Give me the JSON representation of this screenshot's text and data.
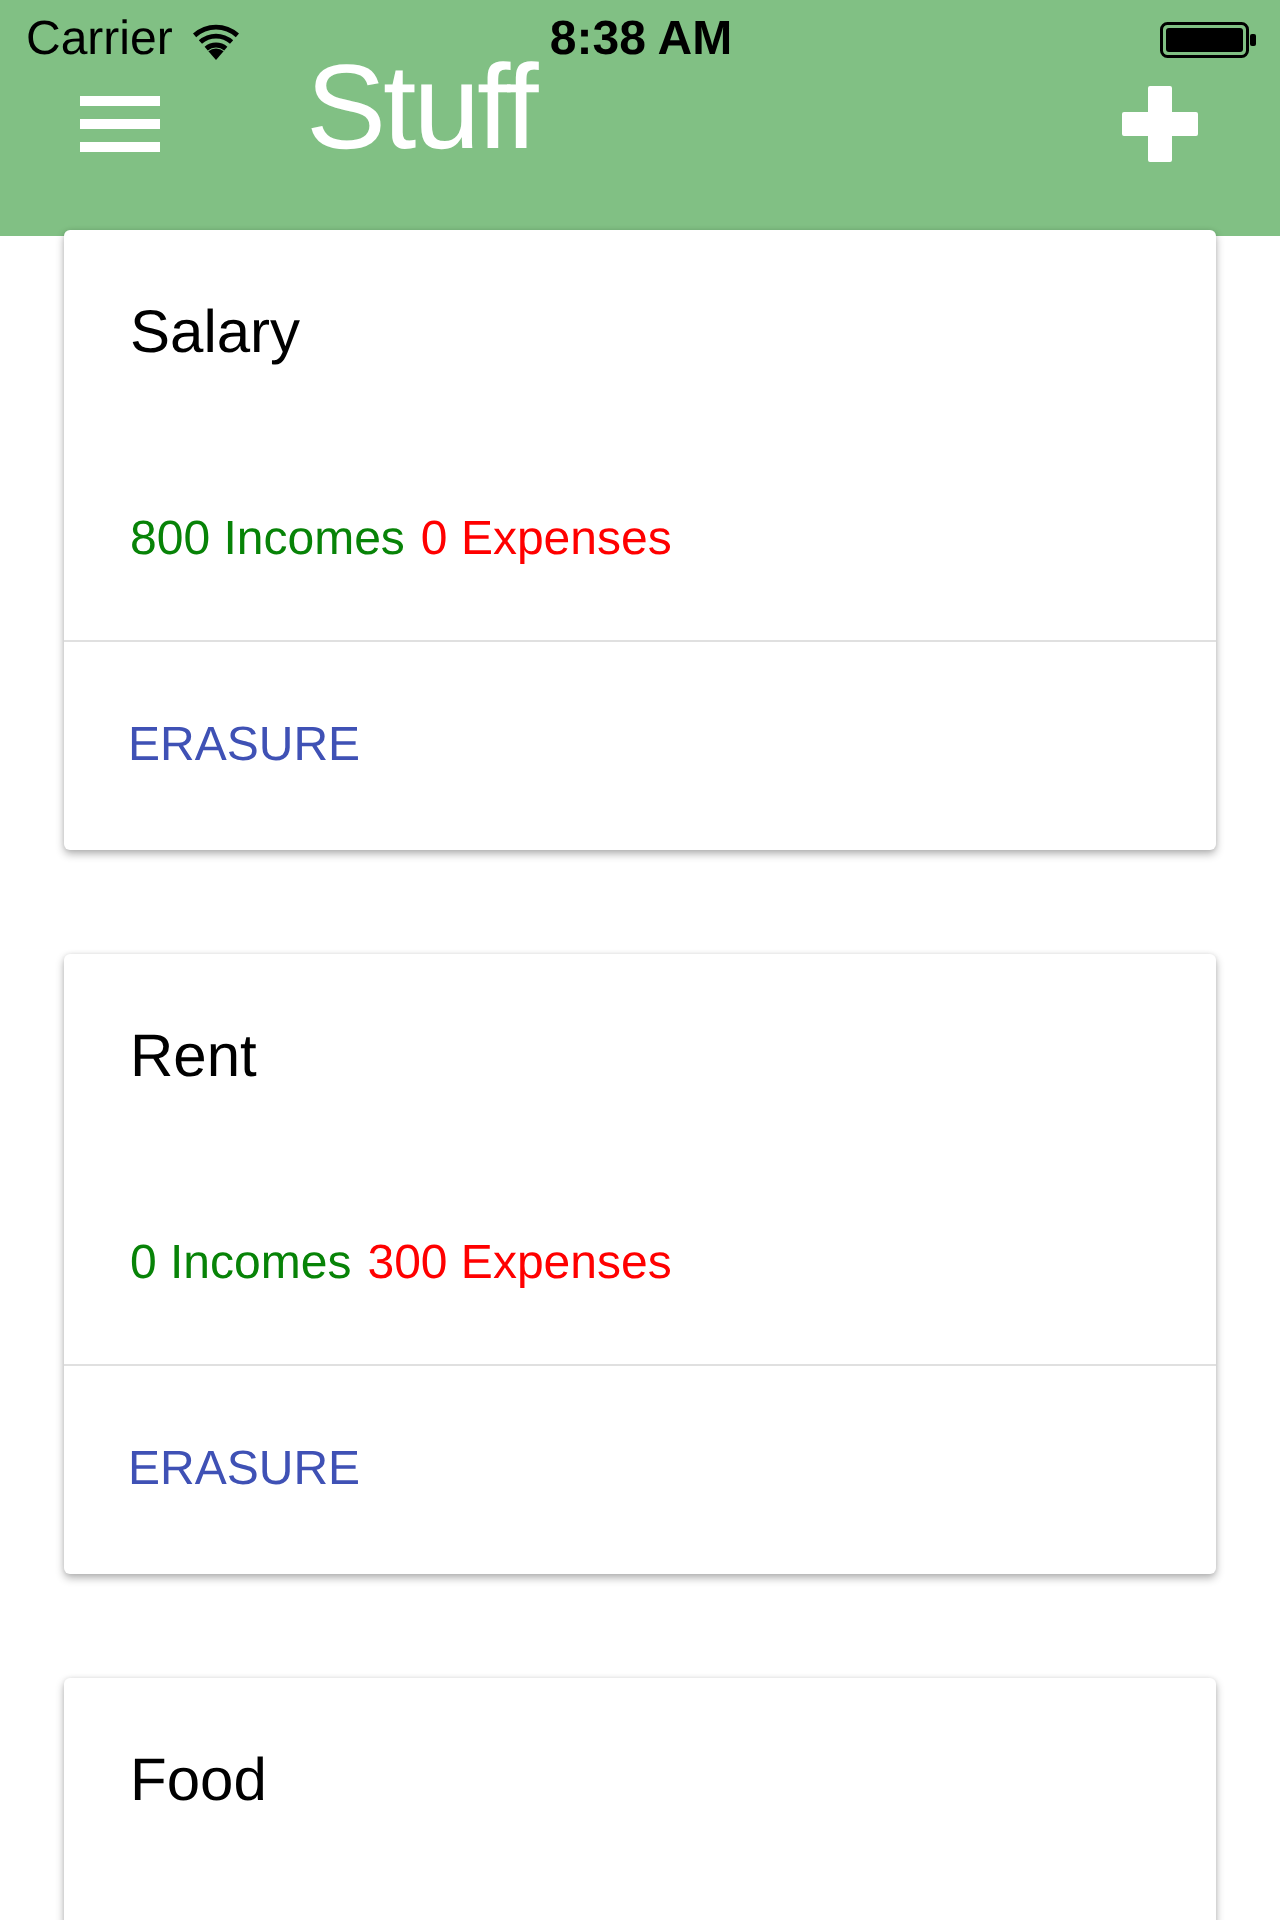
{
  "status_bar": {
    "carrier": "Carrier",
    "time": "8:38 AM"
  },
  "header": {
    "title": "Stuff"
  },
  "cards": [
    {
      "title": "Salary",
      "incomes": "800 Incomes",
      "expenses": "0 Expenses",
      "action": "ERASURE"
    },
    {
      "title": "Rent",
      "incomes": "0 Incomes",
      "expenses": "300 Expenses",
      "action": "ERASURE"
    },
    {
      "title": "Food"
    }
  ]
}
